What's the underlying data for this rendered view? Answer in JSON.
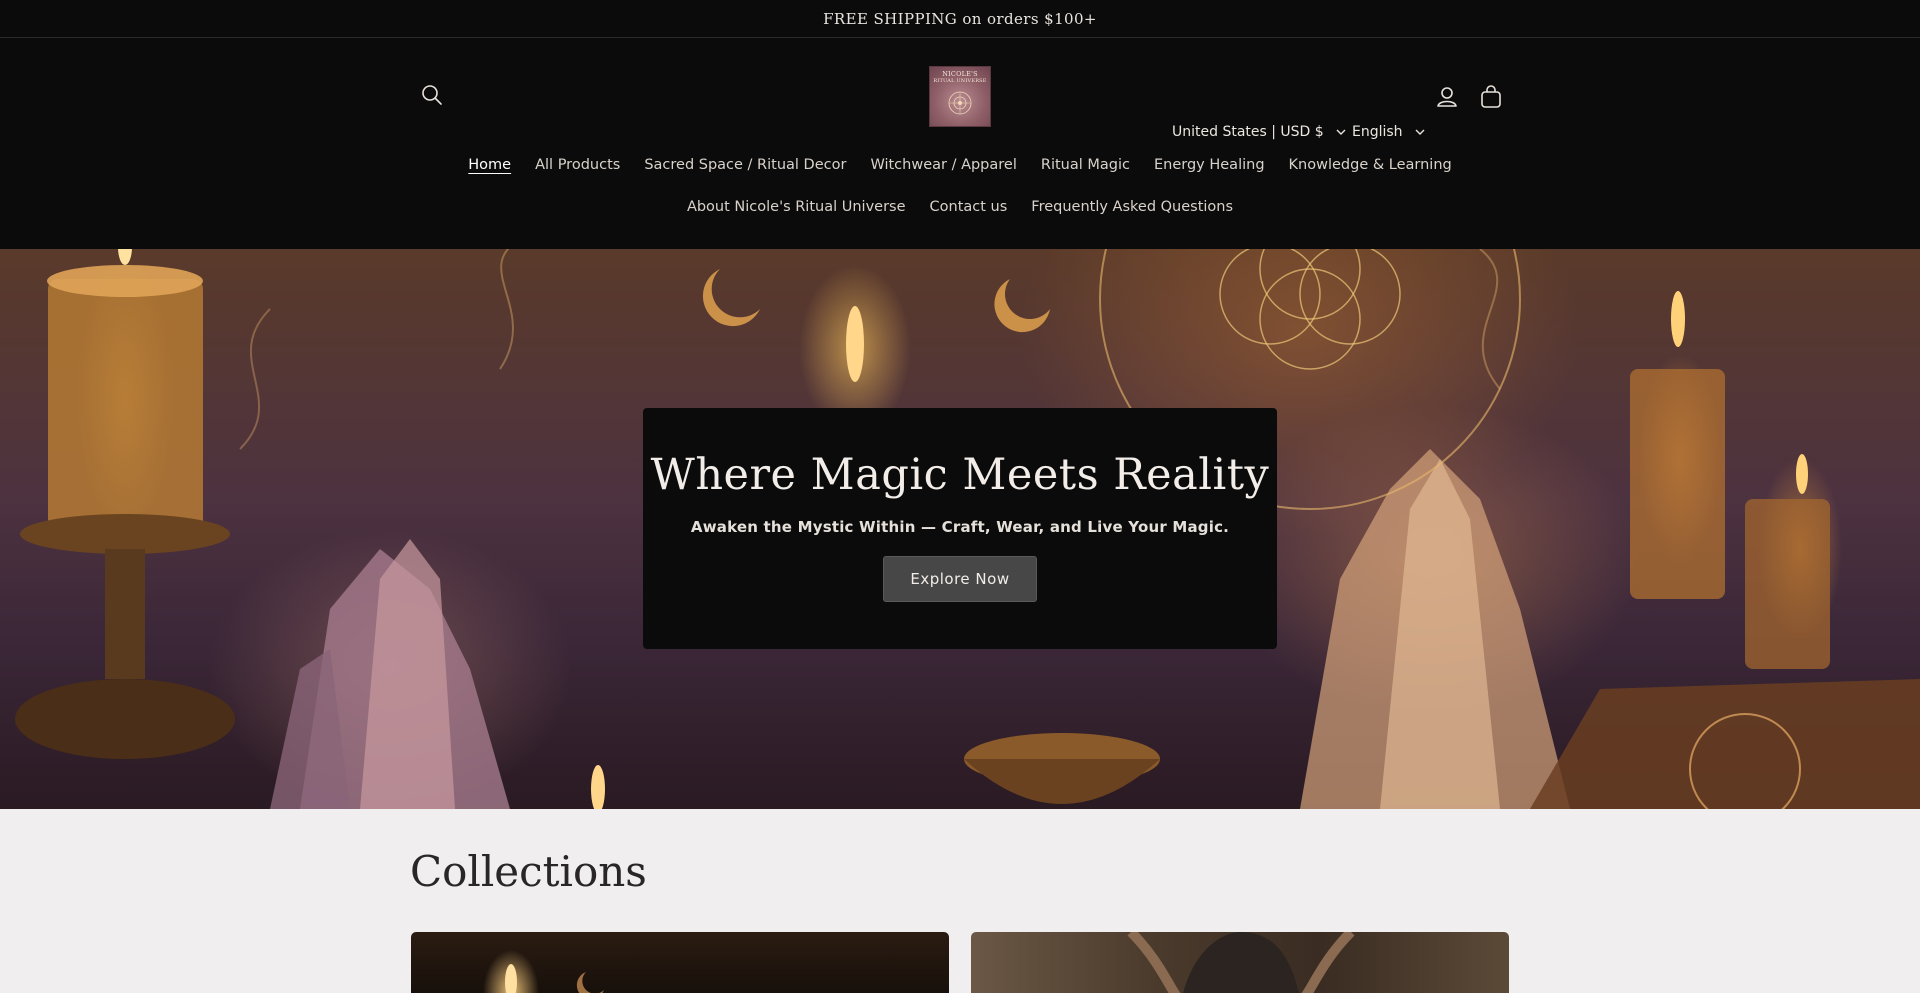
{
  "announcement": {
    "text": "FREE SHIPPING on orders $100+"
  },
  "header": {
    "logo_text_line1": "NICOLE'S",
    "logo_text_line2": "RITUAL UNIVERSE",
    "country_selector": "United States | USD $",
    "language_selector": "English",
    "icons": [
      "search-icon",
      "account-icon",
      "cart-icon"
    ]
  },
  "nav": {
    "row1": [
      {
        "label": "Home",
        "active": true
      },
      {
        "label": "All Products"
      },
      {
        "label": "Sacred Space / Ritual Decor"
      },
      {
        "label": "Witchwear / Apparel"
      },
      {
        "label": "Ritual Magic"
      },
      {
        "label": "Energy Healing"
      },
      {
        "label": "Knowledge & Learning"
      }
    ],
    "row2": [
      {
        "label": "About Nicole's Ritual Universe"
      },
      {
        "label": "Contact us"
      },
      {
        "label": "Frequently Asked Questions"
      }
    ]
  },
  "hero": {
    "title": "Where Magic Meets Reality",
    "subtitle": "Awaken the Mystic Within — Craft, Wear, and Live Your Magic.",
    "button": "Explore Now"
  },
  "collections": {
    "heading": "Collections"
  },
  "colors": {
    "header_bg": "#0b0b0b",
    "page_bg": "#f0eeee",
    "button_bg": "#474747"
  }
}
